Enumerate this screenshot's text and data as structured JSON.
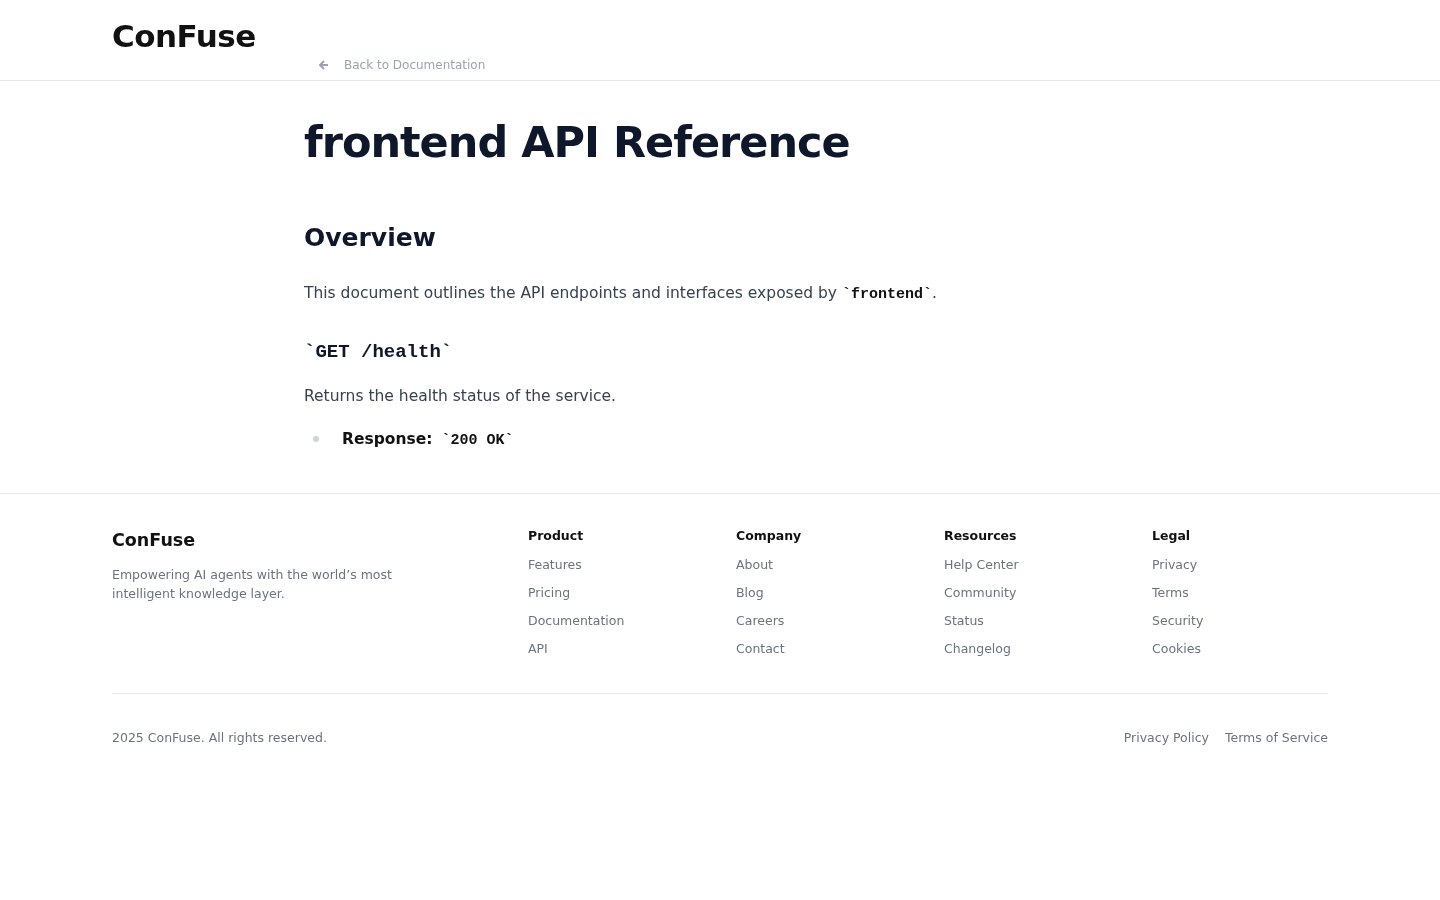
{
  "header": {
    "logo": "ConFuse",
    "back_link": "Back to Documentation"
  },
  "doc": {
    "title": "frontend API Reference",
    "sections": [
      {
        "kind": "h2",
        "text": "Overview"
      },
      {
        "kind": "para",
        "parts": [
          {
            "kind": "text",
            "text": "This document outlines the API endpoints and interfaces exposed by "
          },
          {
            "kind": "code",
            "text": "`frontend`"
          },
          {
            "kind": "text",
            "text": "."
          }
        ]
      },
      {
        "kind": "h3code",
        "text": "`GET /health`"
      },
      {
        "kind": "para",
        "parts": [
          {
            "kind": "text",
            "text": "Returns the health status of the service."
          }
        ]
      },
      {
        "kind": "bullets",
        "items": [
          {
            "parts": [
              {
                "kind": "bold",
                "text": "Response:"
              },
              {
                "kind": "code",
                "text": " `200 OK`"
              }
            ]
          }
        ]
      }
    ]
  },
  "footer": {
    "brand": "ConFuse",
    "tagline": "Empowering AI agents with the world’s most intelligent knowledge layer.",
    "columns": [
      {
        "heading": "Product",
        "links": [
          "Features",
          "Pricing",
          "Documentation",
          "API"
        ]
      },
      {
        "heading": "Company",
        "links": [
          "About",
          "Blog",
          "Careers",
          "Contact"
        ]
      },
      {
        "heading": "Resources",
        "links": [
          "Help Center",
          "Community",
          "Status",
          "Changelog"
        ]
      },
      {
        "heading": "Legal",
        "links": [
          "Privacy",
          "Terms",
          "Security",
          "Cookies"
        ]
      }
    ],
    "copyright": "2025 ConFuse. All rights reserved.",
    "bottom_links": [
      "Privacy Policy",
      "Terms of Service"
    ]
  }
}
